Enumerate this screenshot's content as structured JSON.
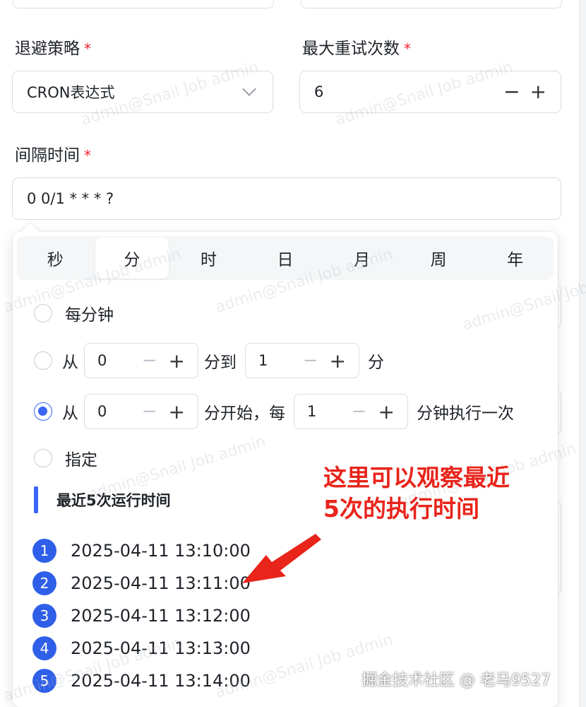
{
  "form": {
    "backoff_label": "退避策略",
    "backoff_value": "CRON表达式",
    "max_retry_label": "最大重试次数",
    "max_retry_value": "6",
    "interval_label": "间隔时间",
    "interval_value": "0 0/1 * * * ?",
    "required_mark": "*"
  },
  "cron": {
    "tabs": [
      "秒",
      "分",
      "时",
      "日",
      "月",
      "周",
      "年"
    ],
    "active_tab": "分",
    "options": {
      "every_label": "每分钟",
      "range_from": "从",
      "range_start": "0",
      "range_mid": "分到",
      "range_end": "1",
      "range_unit": "分",
      "step_from": "从",
      "step_start": "0",
      "step_mid": "分开始，每",
      "step_every": "1",
      "step_unit": "分钟执行一次",
      "specify_label": "指定"
    },
    "selected_option": "step"
  },
  "recent": {
    "title": "最近5次运行时间",
    "items": [
      {
        "n": "1",
        "time": "2025-04-11 13:10:00"
      },
      {
        "n": "2",
        "time": "2025-04-11 13:11:00"
      },
      {
        "n": "3",
        "time": "2025-04-11 13:12:00"
      },
      {
        "n": "4",
        "time": "2025-04-11 13:13:00"
      },
      {
        "n": "5",
        "time": "2025-04-11 13:14:00"
      }
    ]
  },
  "annotation": {
    "line1": "这里可以观察最近",
    "line2": "5次的执行时间"
  },
  "watermark_text": "admin@Snail Job admin",
  "footer_mark": "掘金技术社区 @ 老马9527",
  "colors": {
    "accent": "#3a66f5",
    "badge": "#2f5fe8",
    "required": "#f5222d",
    "annotation": "#e8241b"
  },
  "icons": {
    "select": "chevron-down-icon",
    "stepper_minus": "minus-icon",
    "stepper_plus": "plus-icon",
    "annotation_arrow": "arrow-icon"
  }
}
